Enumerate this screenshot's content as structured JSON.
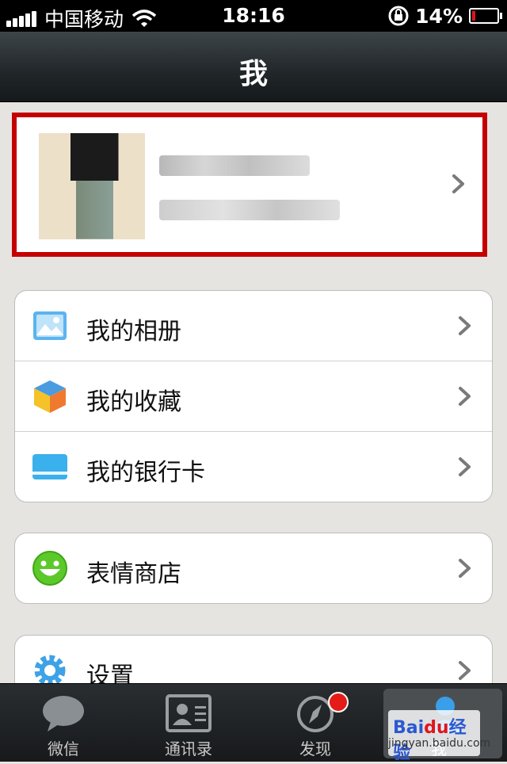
{
  "status_bar": {
    "carrier": "中国移动",
    "time": "18:16",
    "battery": "14%",
    "battery_level": 0.14,
    "battery_color": "#e0151b"
  },
  "nav": {
    "title": "我"
  },
  "profile": {
    "avatar_icon": "avatar-pixelated",
    "chevron_icon": "chevron-right-icon"
  },
  "groups": [
    {
      "items": [
        {
          "label": "我的相册",
          "icon": "photo-album-icon"
        },
        {
          "label": "我的收藏",
          "icon": "favorites-cube-icon"
        },
        {
          "label": "我的银行卡",
          "icon": "bank-card-icon"
        }
      ]
    },
    {
      "items": [
        {
          "label": "表情商店",
          "icon": "smiley-face-icon"
        }
      ]
    },
    {
      "items": [
        {
          "label": "设置",
          "icon": "gear-icon"
        }
      ]
    }
  ],
  "tabs": [
    {
      "label": "微信",
      "icon": "chat-bubble-icon",
      "active": false
    },
    {
      "label": "通讯录",
      "icon": "contacts-card-icon",
      "active": false
    },
    {
      "label": "发现",
      "icon": "compass-icon",
      "active": false,
      "badge": true
    },
    {
      "label": "我",
      "icon": "person-icon",
      "active": true
    }
  ],
  "watermark": {
    "brand_a": "Bai",
    "brand_b": "du",
    "brand_c": "经验",
    "url": "jingyan.baidu.com"
  },
  "colors": {
    "highlight_border": "#c40000",
    "accent_blue": "#3a9ee8"
  }
}
